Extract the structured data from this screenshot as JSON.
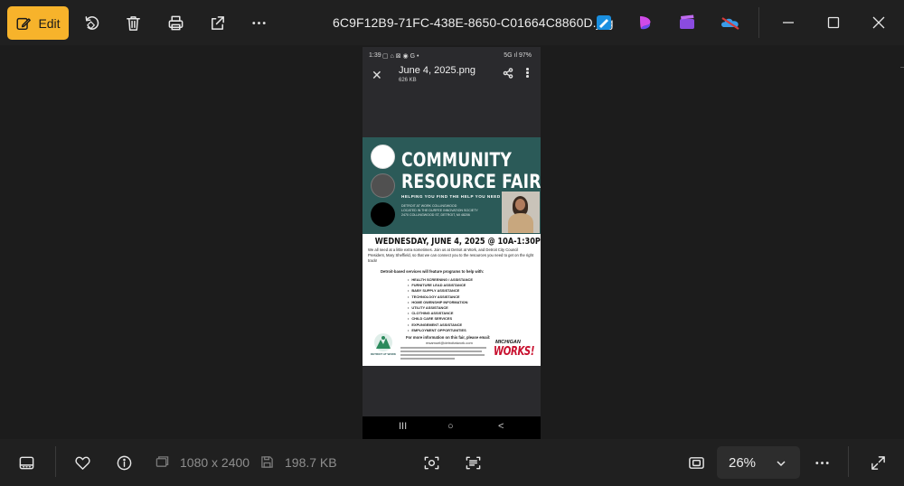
{
  "toolbar": {
    "edit_label": "Edit",
    "file_name": "6C9F12B9-71FC-438E-8650-C01664C8860D.jpg"
  },
  "phone": {
    "status_time": "1:39",
    "status_icons": "▢ ⌂ ⊠ ◉ G •",
    "status_signal": "5G ıl 97%",
    "file_name": "June 4, 2025.png",
    "file_size": "626 KB",
    "nav": {
      "recents": "III",
      "home": "○",
      "back": "<"
    }
  },
  "flyer": {
    "title_line1": "COMMUNITY",
    "title_line2": "RESOURCE FAIR",
    "tagline": "HELPING YOU FIND THE HELP YOU NEED",
    "location_lines": [
      "DETROIT AT WORK COLLINGWOOD",
      "LOCATED IN THE DURFEE INNOVATION SOCIETY",
      "2470 COLLINGWOOD ST, DETROIT, MI 48206"
    ],
    "date": "WEDNESDAY, JUNE 4, 2025 @ 10A-1:30P",
    "intro": "We all need at a little extra sometimes. Join us at Detroit at Work, and Detroit City Council President, Mary Sheffield, so that we can connect you to the resources you need to get on the right track!",
    "services_heading": "Detroit-based services will feature programs to help with:",
    "services": [
      "HEALTH SCREENING / ASSISTANCE",
      "FURNITURE LEAD ASSISTANCE",
      "BABY SUPPLY ASSISTANCE",
      "TECHNOLOGY ASSISTANCE",
      "HOME OWENSHIP INFORMATION",
      "UTILITY ASSISTANCE",
      "CLOTHING ASSISTANCE",
      "CHILD CARE SERVICES",
      "EXPUNGEMENT ASSISTANCE",
      "EMPLOYMENT OPPORTUNITIES"
    ],
    "more_info": "For more information on this fair, please email:",
    "email": "msamuel@detroitatwork.com",
    "logo_text": "DETROIT AT WORK",
    "partner_top": "MICHIGAN",
    "partner_bottom": "WORKS!"
  },
  "bottombar": {
    "dimensions": "1080 x 2400",
    "file_size": "198.7 KB",
    "zoom": "26%"
  },
  "colors": {
    "accent": "#f7b32b",
    "flyer_header": "#2b5a58",
    "partner_red": "#c8102e"
  },
  "icons": {
    "top": [
      "edit-icon",
      "rotate-icon",
      "delete-icon",
      "print-icon",
      "share-icon",
      "more-icon",
      "paint-app-icon",
      "clipchamp-icon",
      "video-editor-icon",
      "onedrive-icon",
      "minimize-icon",
      "maximize-icon",
      "close-icon"
    ],
    "bottom": [
      "filmstrip-icon",
      "favorite-icon",
      "info-icon",
      "dimensions-icon",
      "file-size-icon",
      "visual-search-icon",
      "text-scan-icon",
      "fit-to-window-icon",
      "chevron-down-icon",
      "more-icon",
      "fullscreen-icon"
    ]
  }
}
